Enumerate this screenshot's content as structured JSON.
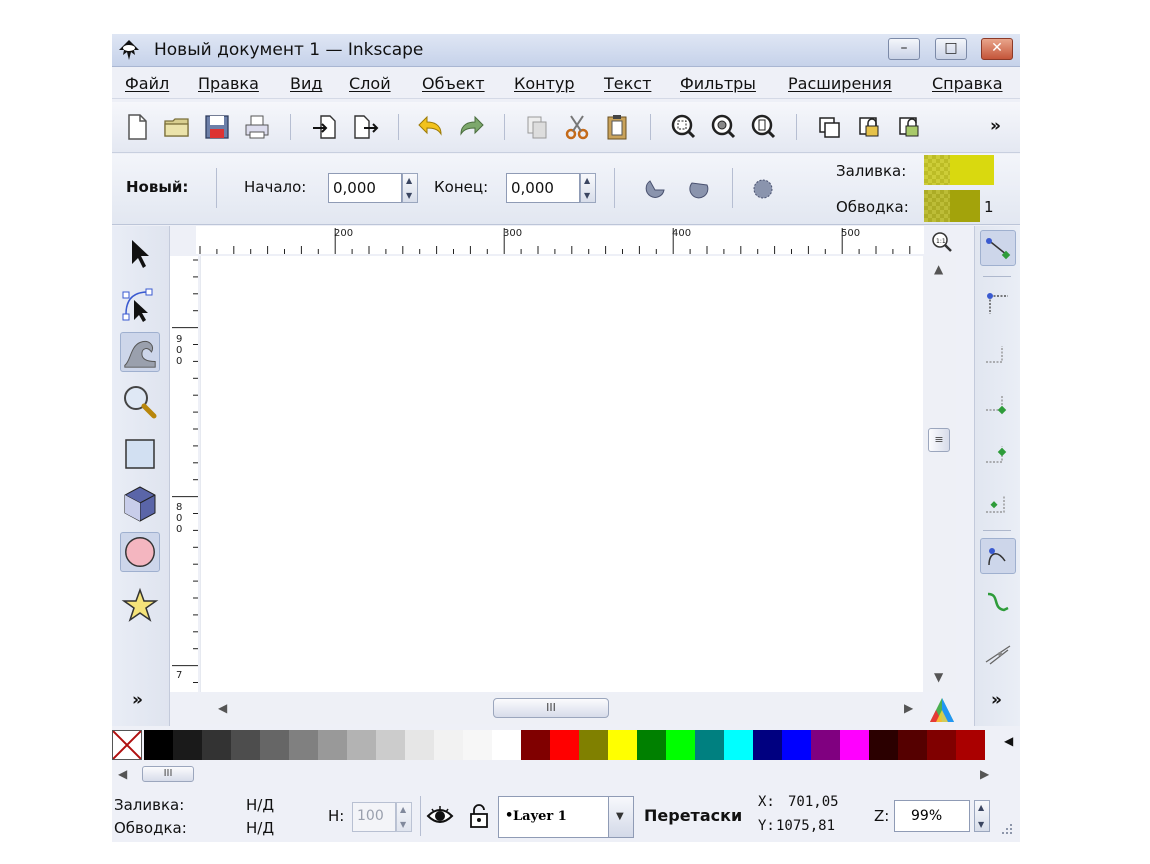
{
  "window": {
    "title": "Новый документ 1 — Inkscape",
    "controls": {
      "minimize": "–",
      "maximize": "□",
      "close": "✕"
    }
  },
  "menu": {
    "items": [
      "Файл",
      "Правка",
      "Вид",
      "Слой",
      "Объект",
      "Контур",
      "Текст",
      "Фильтры",
      "Расширения",
      "Справка"
    ]
  },
  "toolbar": {
    "buttons": [
      "new-document",
      "open",
      "save",
      "print",
      "import",
      "export",
      "undo",
      "redo",
      "duplicate",
      "cut",
      "paste",
      "zoom-selection",
      "zoom-drawing",
      "zoom-page",
      "group",
      "lock",
      "unlock"
    ],
    "more": "»"
  },
  "tool_controls": {
    "mode_label": "Новый:",
    "start_label": "Начало:",
    "start_value": "0,000",
    "end_label": "Конец:",
    "end_value": "0,000",
    "fill_label": "Заливка:",
    "stroke_label": "Обводка:",
    "stroke_width": "1",
    "fill_color": "#d9d90f",
    "stroke_color": "#a3a30b"
  },
  "rulers": {
    "horizontal": [
      "200",
      "300",
      "400",
      "500"
    ],
    "vertical": [
      "900",
      "800",
      "7"
    ]
  },
  "tools": [
    "selector",
    "node-editor",
    "tweak",
    "zoom",
    "rectangle",
    "3d-box",
    "ellipse",
    "star"
  ],
  "toolbox_more": "»",
  "snapbar_more": "»",
  "scrollbars": {
    "thumb_grip": "III",
    "vthumb_grip": "≡"
  },
  "palette": {
    "colors": [
      "#000000",
      "#1a1a1a",
      "#333333",
      "#4d4d4d",
      "#666666",
      "#808080",
      "#999999",
      "#b3b3b3",
      "#cccccc",
      "#e6e6e6",
      "#f2f2f2",
      "#f7f7f7",
      "#ffffff",
      "#800000",
      "#ff0000",
      "#808000",
      "#ffff00",
      "#008000",
      "#00ff00",
      "#008080",
      "#00ffff",
      "#000080",
      "#0000ff",
      "#800080",
      "#ff00ff",
      "#2b0000",
      "#550000",
      "#800000",
      "#aa0000"
    ],
    "more": "◀"
  },
  "status": {
    "fill_label": "Заливка:",
    "fill_value": "Н/Д",
    "stroke_label": "Обводка:",
    "stroke_value": "Н/Д",
    "h_label": "H:",
    "h_value": "100",
    "layer": "Layer 1",
    "message": "Перетаски",
    "x_label": "X:",
    "x_value": "701,05",
    "y_label": "Y:",
    "y_value": "1075,81",
    "z_label": "Z:",
    "zoom": "99%"
  }
}
